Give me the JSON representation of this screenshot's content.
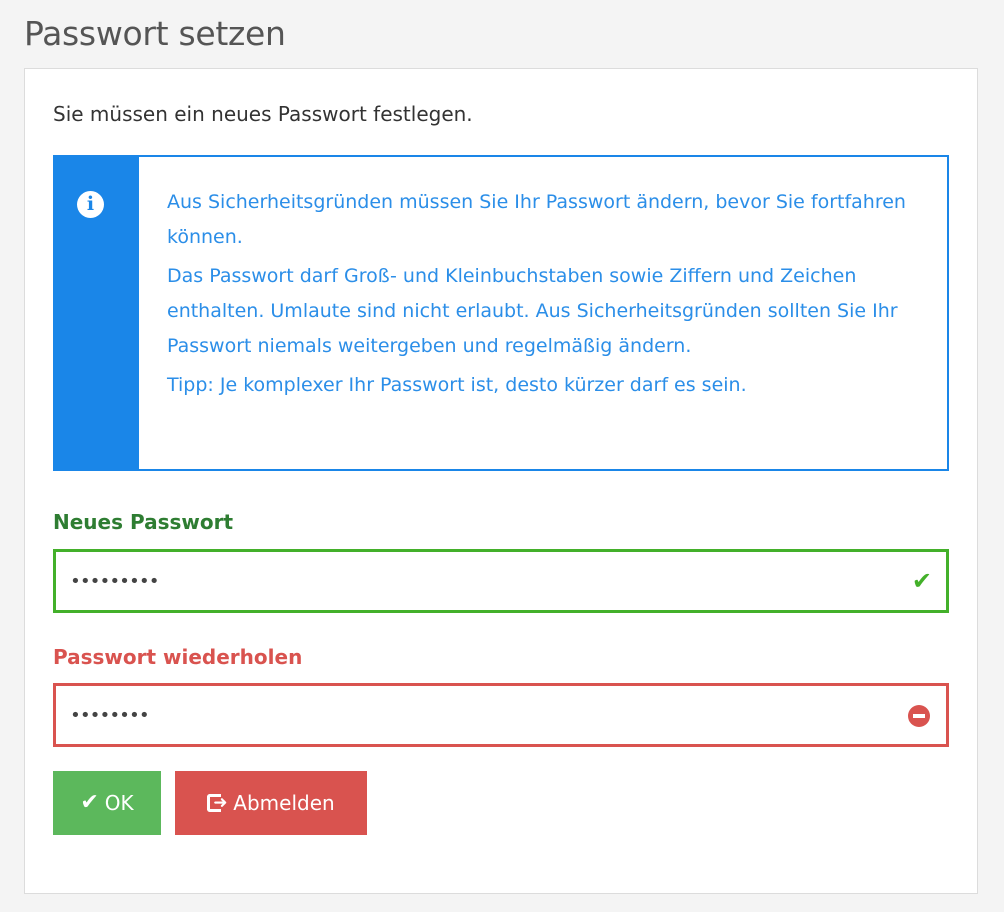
{
  "page": {
    "title": "Passwort setzen"
  },
  "form": {
    "intro": "Sie müssen ein neues Passwort festlegen.",
    "alert": {
      "icon": "info-circle-icon",
      "paragraphs": [
        "Aus Sicherheitsgründen müssen Sie Ihr Passwort ändern, bevor Sie fortfahren können.",
        "Das Passwort darf Groß- und Kleinbuchstaben sowie Ziffern und Zeichen enthalten. Umlaute sind nicht erlaubt. Aus Sicherheitsgründen sollten Sie Ihr Passwort niemals weitergeben und regelmäßig ändern.",
        "Tipp: Je komplexer Ihr Passwort ist, desto kürzer darf es sein."
      ]
    },
    "new_password": {
      "label": "Neues Passwort",
      "value": "•••••••••",
      "status": "valid",
      "status_icon": "check-icon"
    },
    "repeat_password": {
      "label": "Passwort wiederholen",
      "value": "••••••••",
      "status": "invalid",
      "status_icon": "minus-circle-icon"
    },
    "buttons": {
      "ok_label": "OK",
      "ok_icon": "check-icon",
      "logout_label": "Abmelden",
      "logout_icon": "sign-out-icon"
    }
  },
  "colors": {
    "info": "#1a86e8",
    "success": "#43b02a",
    "danger": "#d9534f",
    "ok_button": "#5cb85c"
  }
}
